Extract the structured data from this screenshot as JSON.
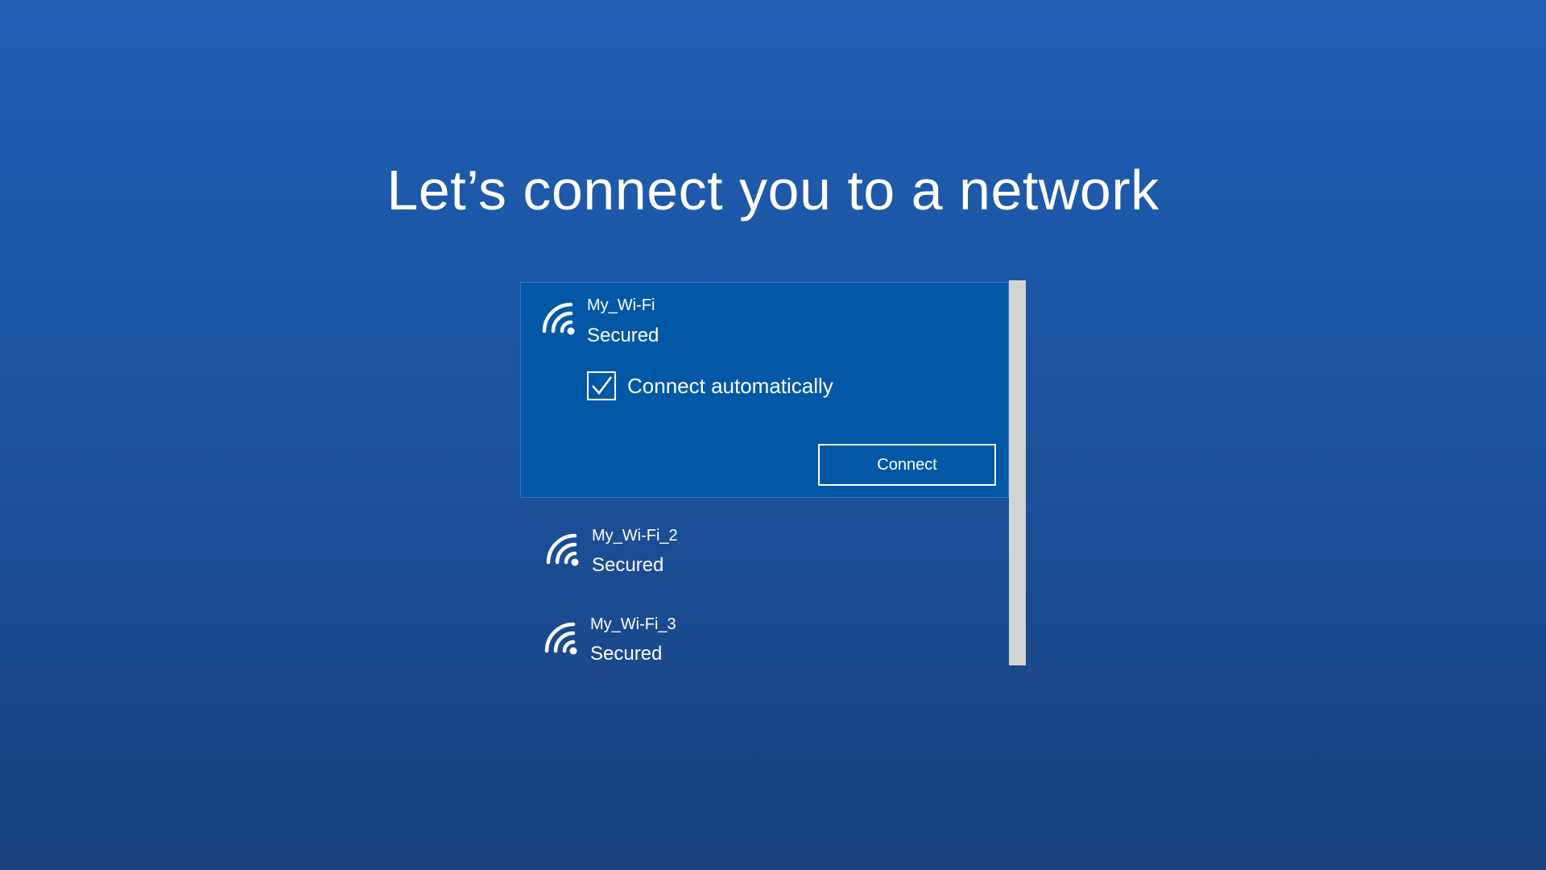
{
  "page": {
    "title": "Let’s connect you to a network"
  },
  "networks": [
    {
      "name": "My_Wi-Fi",
      "status": "Secured",
      "icon": "wifi-icon",
      "connect_automatically_label": "Connect automatically",
      "connect_automatically_checked": true,
      "connect_label": "Connect"
    },
    {
      "name": "My_Wi-Fi_2",
      "status": "Secured",
      "icon": "wifi-icon"
    },
    {
      "name": "My_Wi-Fi_3",
      "status": "Secured",
      "icon": "wifi-icon"
    }
  ],
  "colors": {
    "background_top": "#1f5fb3",
    "background_bottom": "#18417c",
    "selected_item": "#0358a5",
    "scrollbar": "#d4d4d4",
    "text": "#ffffff"
  }
}
